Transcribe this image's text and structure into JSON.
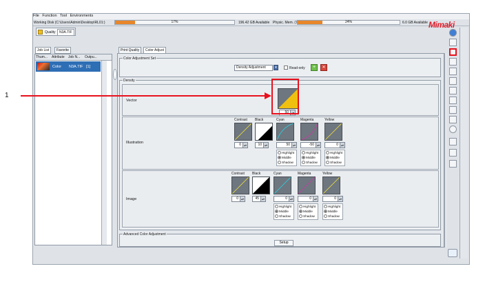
{
  "menu": [
    "File",
    "Function",
    "Tool",
    "Environments"
  ],
  "disk": {
    "path_label": "Working Disk (C:\\Users\\Admin\\Desktop\\RL01:)",
    "disk_percent_label": "17%",
    "disk_fill": 0.17,
    "disk_available": "196.42 GB Available",
    "mem_label": "Physic. Mem. (7.9 GB)",
    "mem_percent_label": "24%",
    "mem_fill": 0.24,
    "mem_available": "6.0 GB Available"
  },
  "logo_text": "Mimaki",
  "top_tabs": [
    "Quality",
    "N3A.TIF"
  ],
  "left_tabs": [
    "Job List",
    "Favorite"
  ],
  "job_columns": [
    "Thum...",
    "Attribute",
    "Job N...",
    "Outpu..."
  ],
  "job_row": {
    "attribute": "Color",
    "name": "N3A.TIF",
    "output": "[1]"
  },
  "main_tabs": [
    "Print Quality",
    "Color Adjust"
  ],
  "color_set": {
    "title": "Color Adjustment Set",
    "selected": "Density Adjustment",
    "readonly_label": "Read-only",
    "add_icon": "+",
    "delete_icon": "✕"
  },
  "density": {
    "title": "Density",
    "vector": {
      "label": "Vector",
      "value": "50"
    },
    "illustration": {
      "label": "Illustration",
      "contrast": {
        "label": "Contrast",
        "value": "0"
      },
      "black": {
        "label": "Black",
        "value": "10"
      },
      "cyan": {
        "label": "Cyan",
        "value": "50"
      },
      "magenta": {
        "label": "Magenta",
        "value": "-50"
      },
      "yellow": {
        "label": "Yellow",
        "value": "0"
      }
    },
    "image": {
      "label": "Image",
      "contrast": {
        "label": "Contrast",
        "value": "0"
      },
      "black": {
        "label": "Black",
        "value": "45"
      },
      "cyan": {
        "label": "Cyan",
        "value": "0"
      },
      "magenta": {
        "label": "Magenta",
        "value": "0"
      },
      "yellow": {
        "label": "Yellow",
        "value": "0"
      }
    },
    "radio_options": [
      "Highlight",
      "Middle",
      "Shadow"
    ]
  },
  "advanced": {
    "title": "Advanced Color Adjustment",
    "setup_label": "Setup"
  },
  "annotation_number": "1",
  "colors": {
    "accent_red": "#e8101c",
    "progress_orange": "#e8862a",
    "selection_blue": "#2e6eb5",
    "cyan": "#30c8d8",
    "magenta": "#c040a0",
    "yellow": "#e0d040"
  }
}
